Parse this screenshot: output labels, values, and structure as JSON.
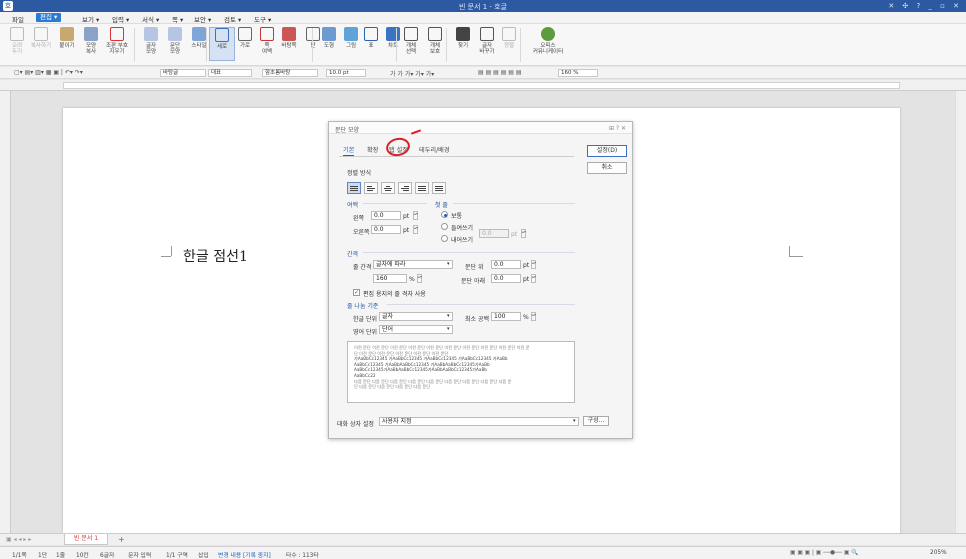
{
  "titlebar": {
    "title": "빈 문서 1 - 호글",
    "logo": "호",
    "controls": "✕ ✣ ? _ ▫ ✕"
  },
  "menu": {
    "file": "파일",
    "edit": "편집 ▾",
    "view": "보기 ▾",
    "input": "입력 ▾",
    "format": "서식 ▾",
    "page": "쪽 ▾",
    "security": "보안 ▾",
    "review": "검토 ▾",
    "tools": "도구 ▾"
  },
  "ribbon": {
    "cut": "오려\n두기",
    "copy": "복사하기",
    "paste": "붙이기",
    "shape_copy": "모양\n복사",
    "format_clear": "조판 부호\n지우기",
    "char_shape": "글자\n모양",
    "para_shape": "문단\n모양",
    "style": "스타일",
    "col_vertical": "세로",
    "col_horizontal": "가로",
    "page_margin": "쪽\n여백",
    "page_bg": "바탕쪽",
    "columns": "단",
    "draw": "도형",
    "picture": "그림",
    "table": "표",
    "chart": "차트",
    "obj_select": "개체\n선택",
    "obj_protect": "개체\n보호",
    "find": "찾기",
    "replace": "글자\n바꾸기",
    "sort": "정렬",
    "office": "오피스\n커뮤니케이터"
  },
  "formatbar": {
    "style": "바탕글",
    "lang": "대표",
    "font": "함초롬바탕",
    "size": "10.0 pt",
    "zoom": "160 %"
  },
  "document": {
    "text": "한글 점선1",
    "tab_name": "빈 문서 1"
  },
  "status": {
    "page": "1/1쪽",
    "col": "1단",
    "line": "1줄",
    "col_num": "10칸",
    "chars": "6글자",
    "input_mode": "문자 입력",
    "section": "1/1 구역",
    "insert": "삽입",
    "track": "변경 내용 [기록 중지]",
    "taja": "타수 : 113타",
    "zoom": "205%"
  },
  "dialog": {
    "title": "문단 모양",
    "title_controls": "⊞ ? ✕",
    "tabs": [
      "기본",
      "확장",
      "탭 설정",
      "테두리/배경"
    ],
    "section_align": "정렬 방식",
    "section_margin": "여백",
    "left_label": "왼쪽",
    "left_value": "0.0",
    "left_unit": "pt",
    "right_label": "오른쪽",
    "right_value": "0.0",
    "right_unit": "pt",
    "section_indent": "첫 줄",
    "indent_normal": "보통",
    "indent_in": "들여쓰기",
    "indent_out": "내어쓰기",
    "indent_value": "0.0",
    "indent_unit": "pt",
    "section_spacing": "간격",
    "linespace_label": "줄 간격",
    "linespace_type": "글자에 따라",
    "linespace_value": "160",
    "linespace_unit": "%",
    "para_before_label": "문단 위",
    "para_before_value": "0.0",
    "para_before_unit": "pt",
    "para_after_label": "문단 아래",
    "para_after_value": "0.0",
    "para_after_unit": "pt",
    "grid_check": "편집 용지의 줄 격자 사용",
    "section_wrap": "줄 나눔 기준",
    "hangul_label": "한글 단위",
    "hangul_value": "글자",
    "min_space_label": "최소 공백",
    "min_space_value": "100",
    "min_space_unit": "%",
    "english_label": "영어 단위",
    "english_value": "단어",
    "preview_lines": [
      "이전 문단 이전 문단 이전 문단 이전 문단 이전 문단 이전 문단 이전 문단 이전 문단 이전 문단 이전 문",
      "단 이전 문단 이전 문단 이전 문단 이전 문단 이전 문단",
      "가AaBbCc12345  가AaBbCc12345  가AaBbCc12345  가AaBbCc12345  가AaBb",
      "AaBbCc12345 가AaBbAaBbCc12345 가AaBbAaBbCc12345가AaBb",
      "AaBbCc12345가AaBbAaBbCc12345가AaBbAaBbCc12345가AaBb",
      "AaBbCc22",
      "다음 문단 다음 문단 다음 문단 다음 문단 다음 문단 다음 문단 다음 문단 다음 문단 다음 문",
      "단 다음 문단 다음 문단 다음 문단 다음 문단"
    ],
    "dialog_setting_label": "대화 상자 설정",
    "dialog_setting_value": "사용자 지정",
    "compose_button": "구성...",
    "ok_button": "설정(D)",
    "cancel_button": "취소"
  }
}
